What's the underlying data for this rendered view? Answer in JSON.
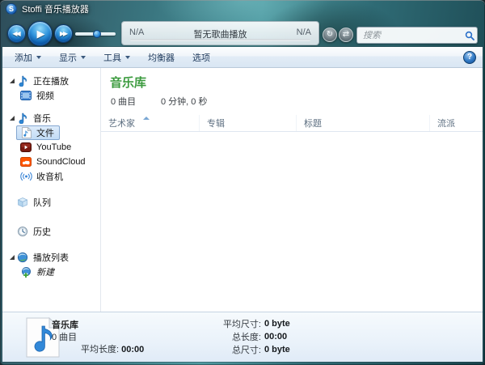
{
  "window": {
    "title": "Stoffi 音乐播放器",
    "logo_glyph": "S"
  },
  "toolbar": {
    "playback": {
      "rewind_glyph": "◀◀",
      "play_glyph": "▶",
      "forward_glyph": "▶▶"
    },
    "track_info": {
      "left": "N/A",
      "center": "暂无歌曲播放",
      "right": "N/A"
    },
    "repeat_glyph": "↻",
    "shuffle_glyph": "⇄",
    "search": {
      "placeholder": "搜索",
      "icon": "search-icon",
      "accent_color": "#2a6fc9"
    }
  },
  "menubar": {
    "items": [
      {
        "label": "添加",
        "has_dropdown": true
      },
      {
        "label": "显示",
        "has_dropdown": true
      },
      {
        "label": "工具",
        "has_dropdown": true
      },
      {
        "label": "均衡器",
        "has_dropdown": false
      },
      {
        "label": "选项",
        "has_dropdown": false
      }
    ],
    "help_label": "?"
  },
  "sidebar": {
    "items": [
      {
        "label": "正在播放",
        "icon": "music-note-icon",
        "type": "group",
        "expanded": true
      },
      {
        "label": "视频",
        "icon": "video-icon",
        "type": "child"
      },
      {
        "label": "音乐",
        "icon": "music-note-icon",
        "type": "group",
        "expanded": true
      },
      {
        "label": "文件",
        "icon": "file-note-icon",
        "type": "child",
        "selected": true
      },
      {
        "label": "YouTube",
        "icon": "youtube-icon",
        "type": "child"
      },
      {
        "label": "SoundCloud",
        "icon": "soundcloud-icon",
        "type": "child"
      },
      {
        "label": "收音机",
        "icon": "radio-icon",
        "type": "child"
      },
      {
        "label": "队列",
        "icon": "queue-cube-icon",
        "type": "solo"
      },
      {
        "label": "历史",
        "icon": "history-clock-icon",
        "type": "solo"
      },
      {
        "label": "播放列表",
        "icon": "playlist-globe-icon",
        "type": "group",
        "expanded": true
      },
      {
        "label": "新建",
        "icon": "playlist-new-icon",
        "type": "child",
        "italic": true
      }
    ],
    "selection_color": "#c2dcf5"
  },
  "main": {
    "title": "音乐库",
    "title_color": "#3c9b3f",
    "track_count": "0 曲目",
    "duration": "0 分钟, 0 秒",
    "columns": [
      "艺术家",
      "专辑",
      "标题",
      "流派"
    ],
    "sorted_column": "艺术家",
    "sort_direction": "asc",
    "rows": []
  },
  "statusbar": {
    "icon": "music-file-icon",
    "name": "音乐库",
    "track_count": "0 曲目",
    "avg_length_label": "平均长度:",
    "avg_length_value": "00:00",
    "avg_size_label": "平均尺寸:",
    "avg_size_value": "0 byte",
    "total_length_label": "总长度:",
    "total_length_value": "00:00",
    "total_size_label": "总尺寸:",
    "total_size_value": "0 byte"
  }
}
